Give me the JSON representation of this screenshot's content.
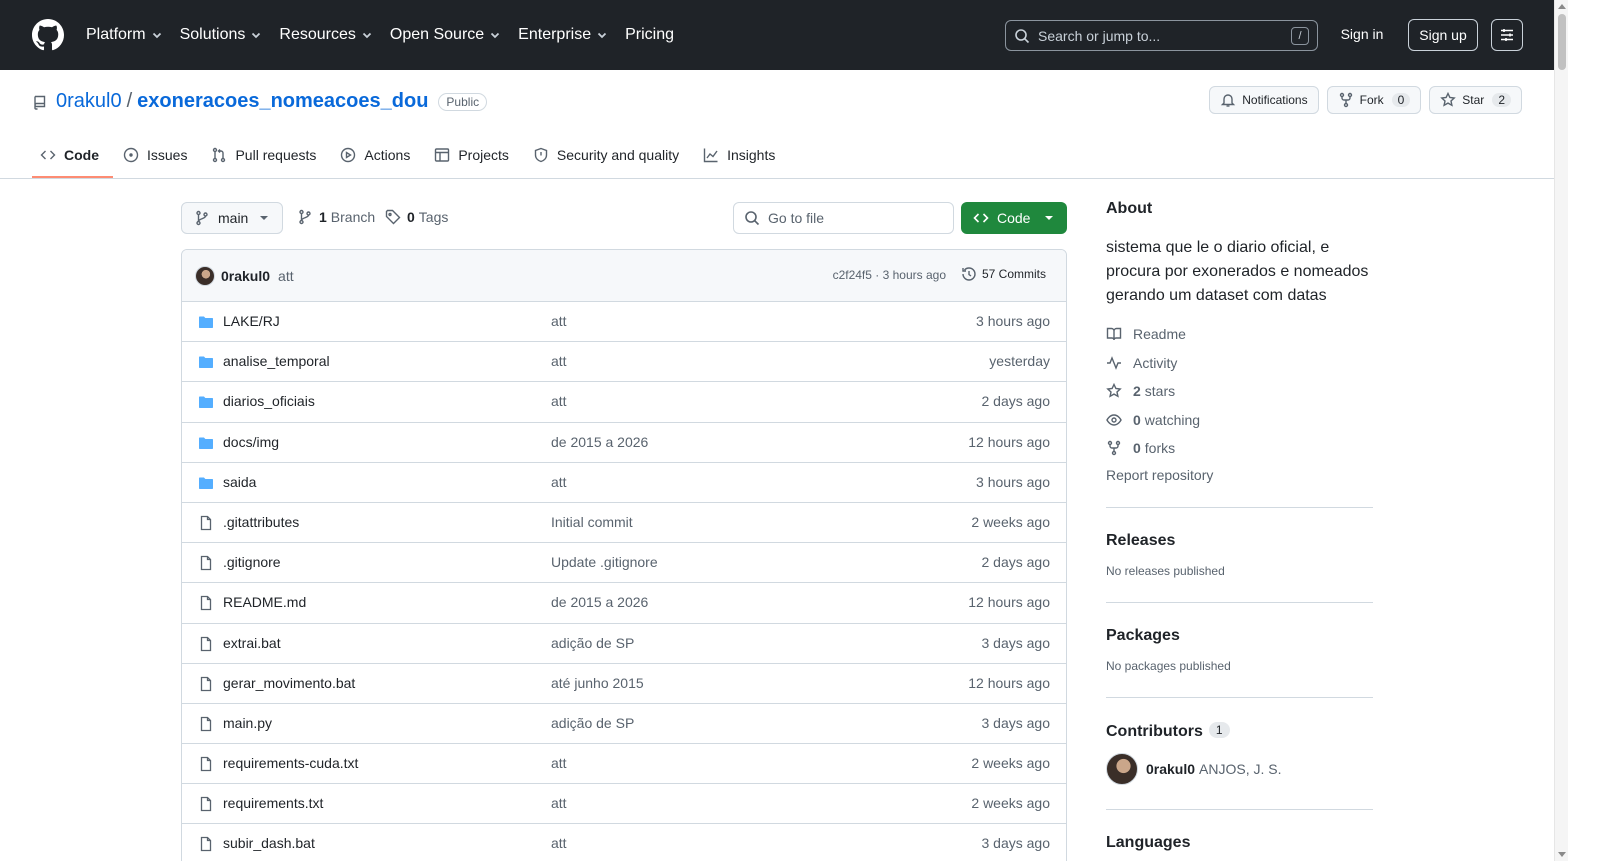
{
  "header": {
    "nav": [
      {
        "label": "Platform",
        "has_menu": true
      },
      {
        "label": "Solutions",
        "has_menu": true
      },
      {
        "label": "Resources",
        "has_menu": true
      },
      {
        "label": "Open Source",
        "has_menu": true
      },
      {
        "label": "Enterprise",
        "has_menu": true
      },
      {
        "label": "Pricing",
        "has_menu": false
      }
    ],
    "search_placeholder": "Search or jump to...",
    "search_shortcut": "/",
    "sign_in": "Sign in",
    "sign_up": "Sign up"
  },
  "repo": {
    "owner": "0rakul0",
    "separator": "/",
    "name": "exoneracoes_nomeacoes_dou",
    "visibility": "Public",
    "notifications_label": "Notifications",
    "fork_label": "Fork",
    "fork_count": "0",
    "star_label": "Star",
    "star_count": "2",
    "tabs": [
      {
        "label": "Code",
        "icon": "code-icon",
        "active": true
      },
      {
        "label": "Issues",
        "icon": "issue-icon",
        "active": false
      },
      {
        "label": "Pull requests",
        "icon": "pull-request-icon",
        "active": false
      },
      {
        "label": "Actions",
        "icon": "play-icon",
        "active": false
      },
      {
        "label": "Projects",
        "icon": "table-icon",
        "active": false
      },
      {
        "label": "Security and quality",
        "icon": "shield-icon",
        "active": false
      },
      {
        "label": "Insights",
        "icon": "graph-icon",
        "active": false
      }
    ]
  },
  "toolbar": {
    "branch": "main",
    "branch_count": "1",
    "branch_label": "Branch",
    "tag_count": "0",
    "tag_label": "Tags",
    "go_to_file_placeholder": "Go to file",
    "code_button": "Code"
  },
  "latest_commit": {
    "author": "0rakul0",
    "message": "att",
    "meta": "c2f24f5 · 3 hours ago",
    "commits_label": "57 Commits"
  },
  "files": [
    {
      "name": "LAKE/RJ",
      "type": "dir",
      "commit": "att",
      "date": "3 hours ago"
    },
    {
      "name": "analise_temporal",
      "type": "dir",
      "commit": "att",
      "date": "yesterday"
    },
    {
      "name": "diarios_oficiais",
      "type": "dir",
      "commit": "att",
      "date": "2 days ago"
    },
    {
      "name": "docs/img",
      "type": "dir",
      "commit": "de 2015 a 2026",
      "date": "12 hours ago"
    },
    {
      "name": "saida",
      "type": "dir",
      "commit": "att",
      "date": "3 hours ago"
    },
    {
      "name": ".gitattributes",
      "type": "file",
      "commit": "Initial commit",
      "date": "2 weeks ago"
    },
    {
      "name": ".gitignore",
      "type": "file",
      "commit": "Update .gitignore",
      "date": "2 days ago"
    },
    {
      "name": "README.md",
      "type": "file",
      "commit": "de 2015 a 2026",
      "date": "12 hours ago"
    },
    {
      "name": "extrai.bat",
      "type": "file",
      "commit": "adição de SP",
      "date": "3 days ago"
    },
    {
      "name": "gerar_movimento.bat",
      "type": "file",
      "commit": "até junho 2015",
      "date": "12 hours ago"
    },
    {
      "name": "main.py",
      "type": "file",
      "commit": "adição de SP",
      "date": "3 days ago"
    },
    {
      "name": "requirements-cuda.txt",
      "type": "file",
      "commit": "att",
      "date": "2 weeks ago"
    },
    {
      "name": "requirements.txt",
      "type": "file",
      "commit": "att",
      "date": "2 weeks ago"
    },
    {
      "name": "subir_dash.bat",
      "type": "file",
      "commit": "att",
      "date": "3 days ago"
    }
  ],
  "sidebar": {
    "about_title": "About",
    "description": "sistema que le o diario oficial, e procura por exonerados e nomeados gerando um dataset com datas",
    "readme": "Readme",
    "activity": "Activity",
    "stars_count": "2",
    "stars_label": "stars",
    "watching_count": "0",
    "watching_label": "watching",
    "forks_count": "0",
    "forks_label": "forks",
    "report": "Report repository",
    "releases_title": "Releases",
    "releases_text": "No releases published",
    "packages_title": "Packages",
    "packages_text": "No packages published",
    "contributors_title": "Contributors",
    "contributors_count": "1",
    "contributor_login": "0rakul0",
    "contributor_name": "ANJOS, J. S.",
    "languages_title": "Languages"
  }
}
